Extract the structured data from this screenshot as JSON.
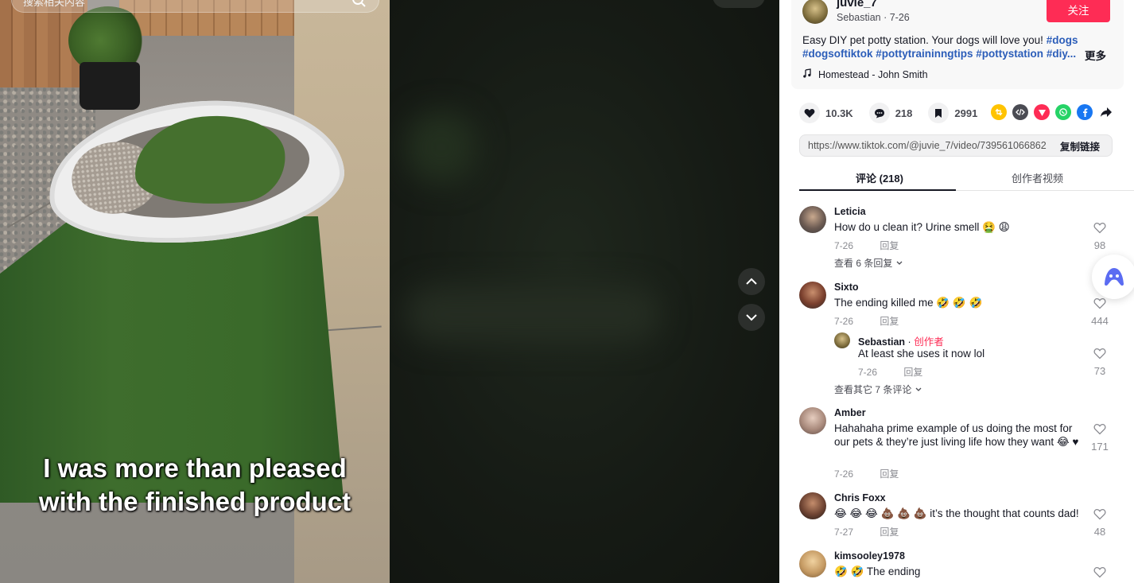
{
  "video": {
    "search_placeholder": "搜索相关内容",
    "caption_line1": "I was more than pleased",
    "caption_line2": "with the finished product"
  },
  "post": {
    "username": "juvie_7",
    "display_name": "Sebastian",
    "date": "7-26",
    "follow_label": "关注",
    "description": "Easy DIY pet potty station. Your dogs will love you!",
    "hashtags": [
      "#dogs",
      "#dogsoftiktok",
      "#pottytraininngtips",
      "#pottystation",
      "#diy..."
    ],
    "more_label": "更多",
    "music": "Homestead - John Smith",
    "likes": "10.3K",
    "comments": "218",
    "saves": "2991",
    "share_url": "https://www.tiktok.com/@juvie_7/video/739561066862...",
    "copy_label": "复制链接"
  },
  "tabs": [
    {
      "label": "评论 (218)",
      "active": true
    },
    {
      "label": "创作者视频",
      "active": false
    }
  ],
  "comments": [
    {
      "user": "Leticia",
      "text": "How do u clean it? Urine smell 🤮 😩",
      "date": "7-26",
      "reply": "回复",
      "likes": "98",
      "view_more": "查看 6 条回复"
    },
    {
      "user": "Sixto",
      "text": "The ending killed me 🤣 🤣 🤣",
      "date": "7-26",
      "reply": "回复",
      "likes": "444",
      "view_more": "查看其它 7 条评论",
      "sub": {
        "user": "Sebastian",
        "creator_tag": "创作者",
        "text": "At least she uses it now lol",
        "date": "7-26",
        "reply": "回复",
        "likes": "73"
      }
    },
    {
      "user": "Amber",
      "text": "Hahahaha prime example of us doing the most for our pets & they’re just living life how they want 😂 ♥",
      "date": "7-26",
      "reply": "回复",
      "likes": "171"
    },
    {
      "user": "Chris Foxx",
      "text": "😂 😂 😂 💩 💩 💩 it’s the thought that counts dad!",
      "date": "7-27",
      "reply": "回复",
      "likes": "48"
    },
    {
      "user": "kimsooley1978",
      "text": "🤣 🤣 The ending",
      "date": "",
      "reply": "",
      "likes": ""
    }
  ],
  "colors": {
    "accent": "#fe2c55",
    "hashtag": "#2b5db9"
  }
}
